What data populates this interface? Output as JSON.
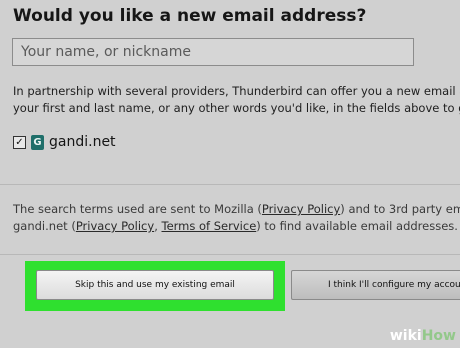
{
  "dialog": {
    "heading": "Would you like a new email address?",
    "name_placeholder": "Your name, or nickname",
    "description_line1": "In partnership with several providers, Thunderbird can offer you a new email ac",
    "description_line2": "your first and last name, or any other words you'd like, in the fields above to ge",
    "provider": {
      "checked": true,
      "check_mark": "✓",
      "logo_icon": "gandi-logo-icon",
      "logo_glyph": "G",
      "name": "gandi.net"
    },
    "terms": {
      "part1": "The search terms used are sent to Mozilla (",
      "privacy_link_1": "Privacy Policy",
      "part2": ") and to 3rd party em",
      "part3": "gandi.net (",
      "privacy_link_2": "Privacy Policy",
      "part4": ", ",
      "tos_link": "Terms of Service",
      "part5": ") to find available email addresses."
    },
    "buttons": {
      "skip_label": "Skip this and use my existing email",
      "configure_label": "I think I'll configure my accou"
    }
  },
  "watermark": {
    "wiki": "wiki",
    "how": "How"
  },
  "colors": {
    "highlight": "#2fe02f",
    "background": "#d0d0d0"
  }
}
